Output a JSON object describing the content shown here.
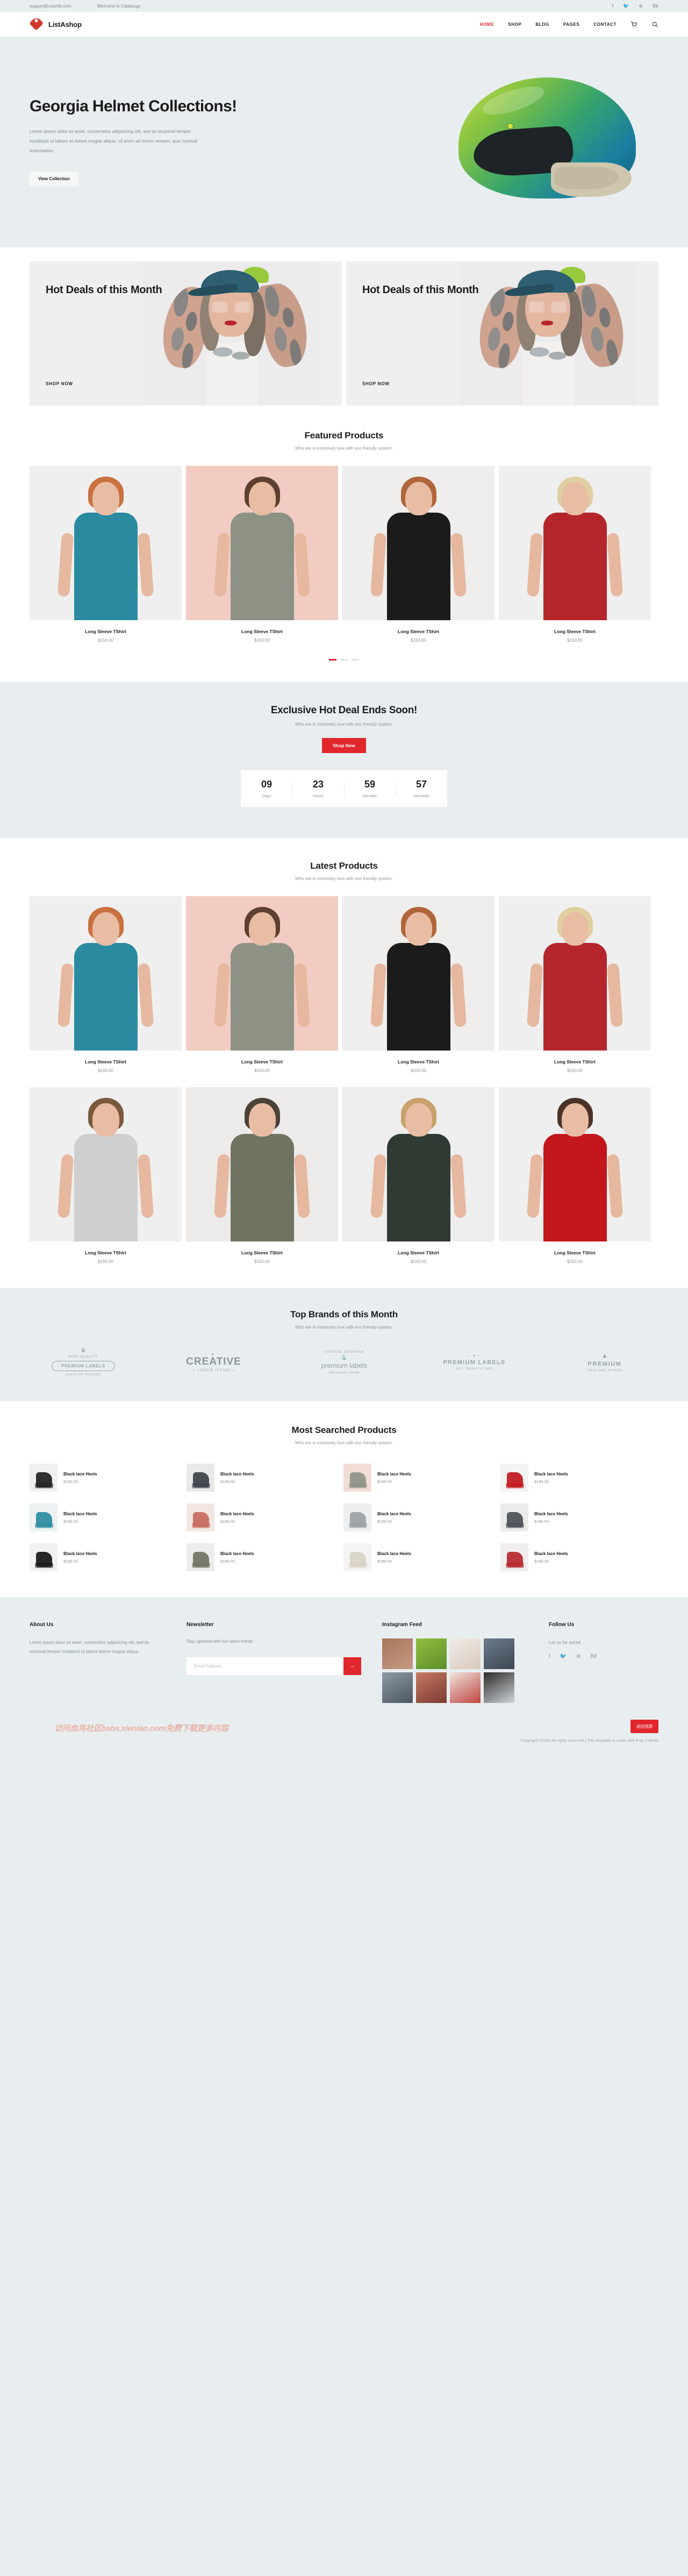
{
  "topbar": {
    "email": "support@colorlib.com",
    "welcome": "Welcome to Catalouge",
    "social": [
      {
        "name": "facebook-icon",
        "glyph": "f"
      },
      {
        "name": "twitter-icon",
        "glyph": "🐦"
      },
      {
        "name": "dribbble-icon",
        "glyph": "⊛"
      },
      {
        "name": "behance-icon",
        "glyph": "Bē"
      }
    ]
  },
  "header": {
    "brand": "ListAshop",
    "nav": [
      {
        "label": "HOME",
        "active": true
      },
      {
        "label": "SHOP",
        "active": false
      },
      {
        "label": "BLOG",
        "active": false
      },
      {
        "label": "PAGES",
        "active": false
      },
      {
        "label": "CONTACT",
        "active": false
      }
    ],
    "cart_icon": "cart-icon",
    "search_icon": "search-icon"
  },
  "hero": {
    "title": "Georgia Helmet Collections!",
    "description": "Lorem ipsum dolor sit amet, consectetur adipisicing elit, sed do eiusmod tempor incididunt ut labore et dolore magna aliqua. Ut enim ad minim veniam, quis nostrud exercitation.",
    "button": "View Collection"
  },
  "deals": [
    {
      "title": "Hot Deals of this Month",
      "link": "SHOP NOW"
    },
    {
      "title": "Hot Deals of this Month",
      "link": "SHOP NOW"
    }
  ],
  "featured": {
    "title": "Featured Products",
    "subtitle": "Who are in extremely love with eco friendly system.",
    "products": [
      {
        "name": "Long Sleeve TShirt",
        "price": "$150.00",
        "color": "#2a8ba0",
        "bg": "#efefef",
        "hair": "#c9713f"
      },
      {
        "name": "Long Sleeve TShirt",
        "price": "$150.00",
        "color": "#8e9285",
        "bg": "#f2ccc2",
        "hair": "#5d4032"
      },
      {
        "name": "Long Sleeve TShirt",
        "price": "$150.00",
        "color": "#1b1b1b",
        "bg": "#efeeec",
        "hair": "#b1653a"
      },
      {
        "name": "Long Sleeve TShirt",
        "price": "$150.00",
        "color": "#b5262c",
        "bg": "#efefef",
        "hair": "#e0cfa0"
      }
    ],
    "dots": 3,
    "active_dot": 0
  },
  "countdown": {
    "title": "Exclusive Hot Deal Ends Soon!",
    "subtitle": "Who are in extremely love with eco friendly system.",
    "button": "Shop Now",
    "units": [
      {
        "value": "09",
        "label": "Days"
      },
      {
        "value": "23",
        "label": "Hours"
      },
      {
        "value": "59",
        "label": "Minutes"
      },
      {
        "value": "57",
        "label": "Seconds"
      }
    ]
  },
  "latest": {
    "title": "Latest Products",
    "subtitle": "Who are in extremely love with eco friendly system.",
    "products": [
      {
        "name": "Long Sleeve TShirt",
        "price": "$150.00",
        "color": "#2a8ba0",
        "bg": "#efefef",
        "hair": "#c9713f"
      },
      {
        "name": "Long Sleeve TShirt",
        "price": "$150.00",
        "color": "#8e9285",
        "bg": "#f2ccc2",
        "hair": "#5d4032"
      },
      {
        "name": "Long Sleeve TShirt",
        "price": "$150.00",
        "color": "#1b1b1b",
        "bg": "#efeeec",
        "hair": "#b1653a"
      },
      {
        "name": "Long Sleeve TShirt",
        "price": "$150.00",
        "color": "#b5262c",
        "bg": "#efefef",
        "hair": "#e0cfa0"
      },
      {
        "name": "Long Sleeve TShirt",
        "price": "$150.00",
        "color": "#cfcfcf",
        "bg": "#efefef",
        "hair": "#7b5a3c"
      },
      {
        "name": "Long Sleeve TShirt",
        "price": "$150.00",
        "color": "#6f7360",
        "bg": "#ecebe9",
        "hair": "#4b4238"
      },
      {
        "name": "Long Sleeve TShirt",
        "price": "$150.00",
        "color": "#2f3a33",
        "bg": "#eeeeee",
        "hair": "#c9a26b"
      },
      {
        "name": "Long Sleeve TShirt",
        "price": "$150.00",
        "color": "#c3161d",
        "bg": "#efefef",
        "hair": "#4a3326"
      }
    ]
  },
  "brands": {
    "title": "Top Brands of this Month",
    "subtitle": "Who are in extremely love with eco friendly system.",
    "items": [
      {
        "kind": "premium-labels",
        "crown": "♛",
        "top": "HIGH QUALITY",
        "name": "· PREMIUM LABELS ·",
        "bottom": "CREATIVE PASSION"
      },
      {
        "kind": "creative",
        "top": "· ★ ·",
        "name": "CREATIVE",
        "bottom": "— LOREM IPSUM —"
      },
      {
        "kind": "vintage-premium",
        "top": "VINTAGE PREMIUM",
        "anchor": "⚓",
        "name": "premium labels",
        "bottom": "· High quality vintage ·"
      },
      {
        "kind": "premium-labels-2",
        "top": "— ★ —",
        "name": "PREMIUM LABELS",
        "bottom": "EST. QUALITY 1985"
      },
      {
        "kind": "premium",
        "top": "▲",
        "name": "PREMIUM",
        "bottom": "ORIGINAL BRAND"
      }
    ]
  },
  "most_searched": {
    "title": "Most Searched Products",
    "subtitle": "Who are in extremely love with eco friendly system.",
    "items": [
      {
        "name": "Black lace Heels",
        "price": "$189.00",
        "thumb": "heel",
        "c1": "#1f1f1f",
        "c2": "#f0f0f0"
      },
      {
        "name": "Black lace Heels",
        "price": "$189.00",
        "thumb": "man",
        "c1": "#3b4048",
        "c2": "#e9e9e9"
      },
      {
        "name": "Black lace Heels",
        "price": "$189.00",
        "thumb": "woman",
        "c1": "#8e9285",
        "c2": "#f2ddd6"
      },
      {
        "name": "Black lace Heels",
        "price": "$189.00",
        "thumb": "redheel",
        "c1": "#c3161d",
        "c2": "#f3f3f3"
      },
      {
        "name": "Black lace Heels",
        "price": "$189.00",
        "thumb": "blueshirt",
        "c1": "#2a8ba0",
        "c2": "#eef1f2"
      },
      {
        "name": "Black lace Heels",
        "price": "$189.00",
        "thumb": "yoga",
        "c1": "#c76a5d",
        "c2": "#f2e6e2"
      },
      {
        "name": "Black lace Heels",
        "price": "$189.00",
        "thumb": "grey",
        "c1": "#9aa0a4",
        "c2": "#efefef"
      },
      {
        "name": "Black lace Heels",
        "price": "$189.00",
        "thumb": "man2",
        "c1": "#4a4f55",
        "c2": "#ebebeb"
      },
      {
        "name": "Black lace Heels",
        "price": "$189.00",
        "thumb": "blackdress",
        "c1": "#161616",
        "c2": "#f1f1f1"
      },
      {
        "name": "Black lace Heels",
        "price": "$189.00",
        "thumb": "camo",
        "c1": "#6f7360",
        "c2": "#ececec"
      },
      {
        "name": "Black lace Heels",
        "price": "$189.00",
        "thumb": "whiteheel",
        "c1": "#d8d2c6",
        "c2": "#f4f4f4"
      },
      {
        "name": "Black lace Heels",
        "price": "$189.00",
        "thumb": "reddress",
        "c1": "#b5262c",
        "c2": "#f0eeee"
      }
    ]
  },
  "footer": {
    "about": {
      "title": "About Us",
      "text": "Lorem ipsum dolor sit amet, consectetur adipisicing elit, sed do eiusmod tempor incididunt ut labore dolore magna aliqua."
    },
    "newsletter": {
      "title": "Newsletter",
      "text": "Stay updated with our latest trends",
      "placeholder": "Email Address",
      "value": "",
      "submit_icon": "arrow-right-icon"
    },
    "instagram": {
      "title": "Instagram Feed",
      "cells": [
        {
          "name": "insta-1",
          "c1": "#a9755c",
          "c2": "#c49a82"
        },
        {
          "name": "insta-2",
          "c1": "#8fbe3e",
          "c2": "#5f8f2a"
        },
        {
          "name": "insta-3",
          "c1": "#f0ece6",
          "c2": "#d8c9bc"
        },
        {
          "name": "insta-4",
          "c1": "#6c7d8c",
          "c2": "#3d4752"
        },
        {
          "name": "insta-5",
          "c1": "#8d9aa6",
          "c2": "#4c5660"
        },
        {
          "name": "insta-6",
          "c1": "#c77a62",
          "c2": "#7b3a33"
        },
        {
          "name": "insta-7",
          "c1": "#efe4dc",
          "c2": "#c0453f"
        },
        {
          "name": "insta-8",
          "c1": "#2b2b2b",
          "c2": "#cfd4d6"
        }
      ]
    },
    "follow": {
      "title": "Follow Us",
      "text": "Let us be social",
      "social": [
        {
          "name": "facebook-icon",
          "glyph": "f"
        },
        {
          "name": "twitter-icon",
          "glyph": "🐦"
        },
        {
          "name": "dribbble-icon",
          "glyph": "⊛"
        },
        {
          "name": "behance-icon",
          "glyph": "Bē"
        }
      ]
    },
    "watermark": "访问血鸟社区bsbs.xieniao.com免费下载更多内容",
    "copyright": "Copyright ©2024 All rights reserved | This template is made with ♥ by Colorlib",
    "back_to_top": "返回顶部"
  }
}
